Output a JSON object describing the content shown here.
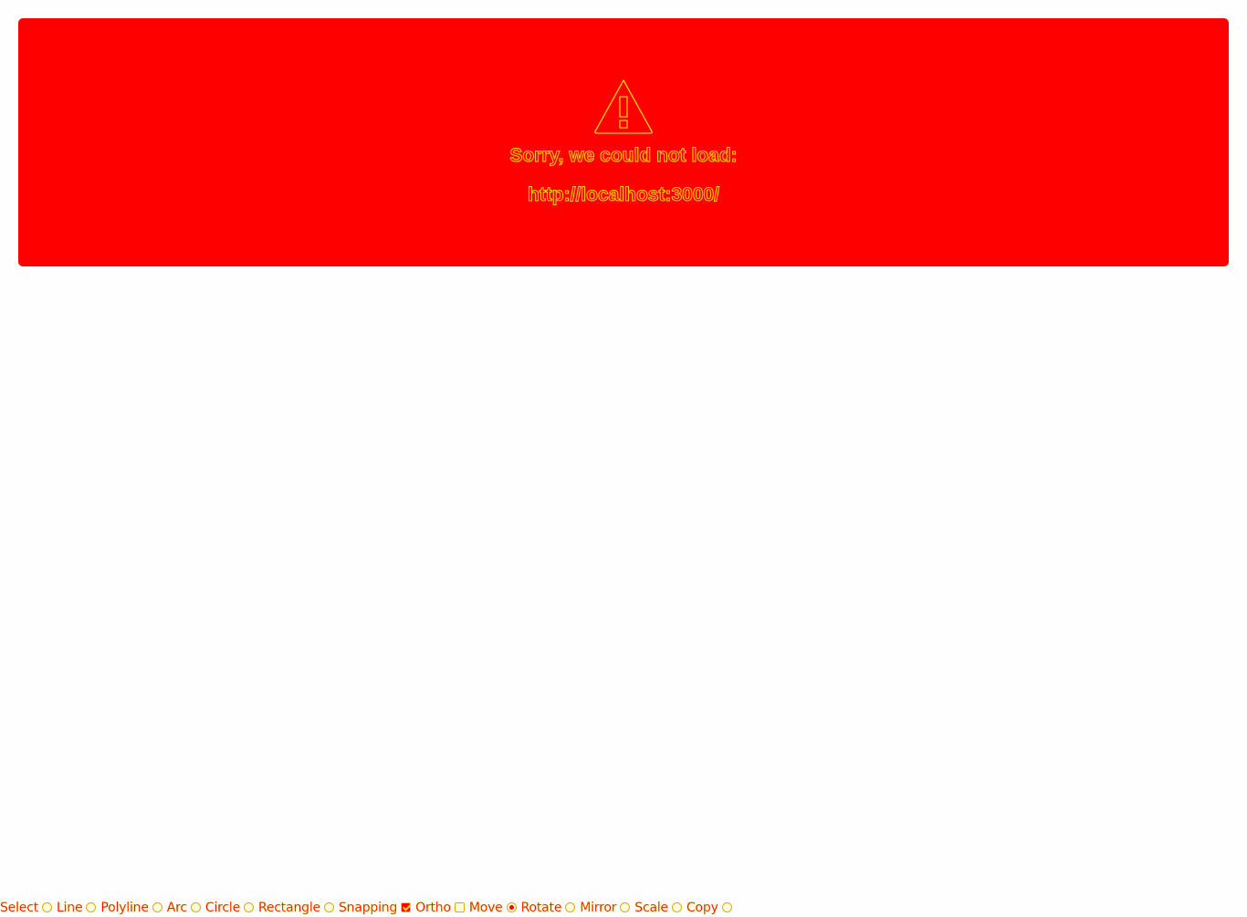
{
  "error": {
    "icon": "warning-triangle-icon",
    "message": "Sorry, we could not load:",
    "url": "http://localhost:3000/"
  },
  "toolbar": {
    "items": [
      {
        "label": "Select",
        "control": "radio",
        "checked": false
      },
      {
        "label": "Line",
        "control": "radio",
        "checked": false
      },
      {
        "label": "Polyline",
        "control": "radio",
        "checked": false
      },
      {
        "label": "Arc",
        "control": "radio",
        "checked": false
      },
      {
        "label": "Circle",
        "control": "radio",
        "checked": false
      },
      {
        "label": "Rectangle",
        "control": "radio",
        "checked": false
      },
      {
        "label": "Snapping",
        "control": "checkbox",
        "checked": true
      },
      {
        "label": "Ortho",
        "control": "checkbox",
        "checked": false
      },
      {
        "label": "Move",
        "control": "radio",
        "checked": true
      },
      {
        "label": "Rotate",
        "control": "radio",
        "checked": false
      },
      {
        "label": "Mirror",
        "control": "radio",
        "checked": false
      },
      {
        "label": "Scale",
        "control": "radio",
        "checked": false
      },
      {
        "label": "Copy",
        "control": "radio",
        "checked": false
      }
    ]
  },
  "colors": {
    "panel": "#ff0000",
    "outline": "#ffd400",
    "background": "#fefefe"
  }
}
